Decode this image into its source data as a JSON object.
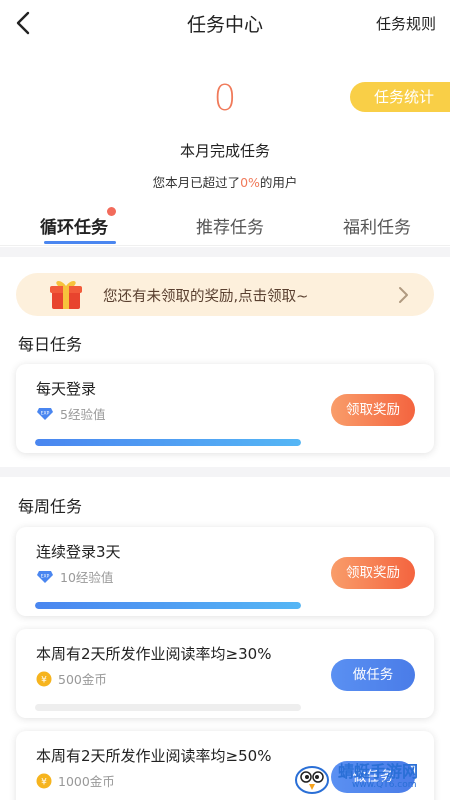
{
  "nav": {
    "title": "任务中心",
    "rules": "任务规则"
  },
  "stats": {
    "count": "0",
    "stat_button": "任务统计",
    "label": "本月完成任务",
    "sub_prefix": "您本月已超过了",
    "sub_pct": "0%",
    "sub_suffix": "的用户"
  },
  "tabs": [
    {
      "label": "循环任务",
      "active": true,
      "badge": true
    },
    {
      "label": "推荐任务",
      "active": false
    },
    {
      "label": "福利任务",
      "active": false
    }
  ],
  "banner": {
    "text": "您还有未领取的奖励,点击领取~"
  },
  "daily": {
    "title": "每日任务",
    "tasks": [
      {
        "name": "每天登录",
        "reward": "5经验值",
        "reward_icon": "exp-diamond-icon",
        "progress": 1.0,
        "button": "领取奖励",
        "button_style": "orange"
      }
    ]
  },
  "weekly": {
    "title": "每周任务",
    "tasks": [
      {
        "name": "连续登录3天",
        "reward": "10经验值",
        "reward_icon": "exp-diamond-icon",
        "progress": 1.0,
        "button": "领取奖励",
        "button_style": "orange"
      },
      {
        "name": "本周有2天所发作业阅读率均≥30%",
        "reward": "500金币",
        "reward_icon": "gold-coin-icon",
        "progress": 0.0,
        "button": "做任务",
        "button_style": "blue"
      },
      {
        "name": "本周有2天所发作业阅读率均≥50%",
        "reward": "1000金币",
        "reward_icon": "gold-coin-icon",
        "progress": 0.0,
        "button": "做任务",
        "button_style": "blue"
      }
    ]
  },
  "watermark": {
    "text": "蜻蜓手游网",
    "url": "www.QT6.com"
  },
  "colors": {
    "accent_orange": "#f4643f",
    "accent_blue": "#4a86f0",
    "stat_yellow": "#f9cf47",
    "count_red": "#f07a5a"
  }
}
